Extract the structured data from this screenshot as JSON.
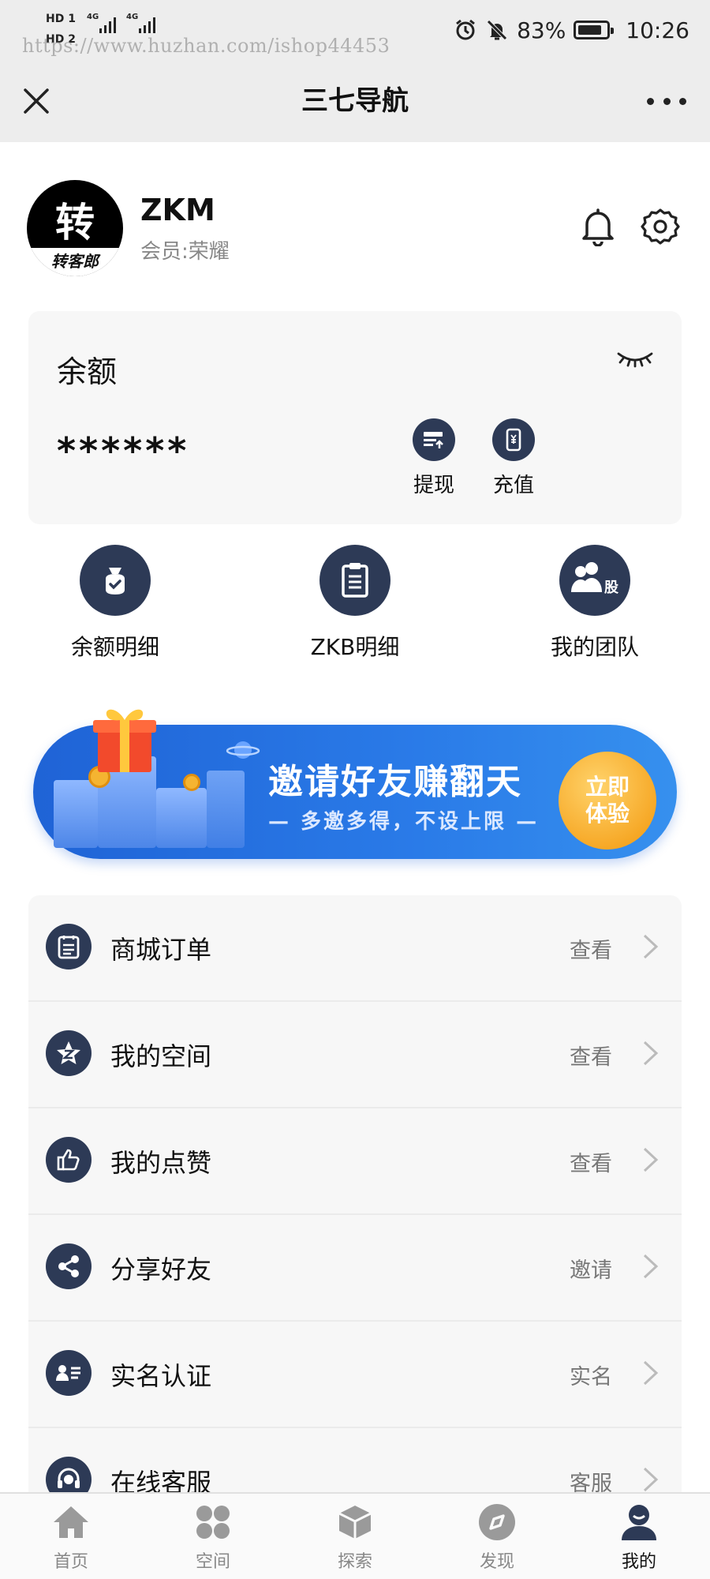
{
  "status_bar": {
    "net1": "HD 1",
    "net2": "HD 2",
    "signal1": "4G",
    "signal2": "4G",
    "watermark": "https://www.huzhan.com/ishop44453",
    "battery": "83%",
    "battery_level": 0.83,
    "time": "10:26",
    "icons": [
      "alarm-icon",
      "mute-icon",
      "battery-icon"
    ]
  },
  "title_bar": {
    "title": "三七导航",
    "close_icon": "close-icon",
    "more_icon": "more-icon"
  },
  "profile": {
    "avatar_main": "转",
    "avatar_band": "转客郎",
    "name": "ZKM",
    "member_level": "会员:荣耀",
    "icons": [
      "bell-icon",
      "gear-icon"
    ]
  },
  "balance": {
    "title": "余额",
    "value": "******",
    "hidden_icon": "eye-closed-icon",
    "actions": [
      {
        "label": "提现",
        "icon": "withdraw-icon"
      },
      {
        "label": "充值",
        "icon": "recharge-icon"
      }
    ]
  },
  "quick_links": [
    {
      "label": "余额明细",
      "icon": "money-bag-icon"
    },
    {
      "label": "ZKB明细",
      "icon": "clipboard-icon"
    },
    {
      "label": "我的团队",
      "icon": "team-icon",
      "badge": "股"
    }
  ],
  "banner": {
    "title": "邀请好友赚翻天",
    "subtitle": "— 多邀多得，不设上限 —",
    "button_line1": "立即",
    "button_line2": "体验"
  },
  "menu": [
    {
      "label": "商城订单",
      "action": "查看",
      "icon": "order-icon"
    },
    {
      "label": "我的空间",
      "action": "查看",
      "icon": "space-icon"
    },
    {
      "label": "我的点赞",
      "action": "查看",
      "icon": "thumbs-up-icon"
    },
    {
      "label": "分享好友",
      "action": "邀请",
      "icon": "share-icon"
    },
    {
      "label": "实名认证",
      "action": "实名",
      "icon": "id-card-icon"
    },
    {
      "label": "在线客服",
      "action": "客服",
      "icon": "headset-icon"
    }
  ],
  "bottom_nav": {
    "active": 4,
    "items": [
      {
        "label": "首页",
        "icon": "home-icon"
      },
      {
        "label": "空间",
        "icon": "grid-icon"
      },
      {
        "label": "探索",
        "icon": "cube-icon"
      },
      {
        "label": "发现",
        "icon": "compass-icon"
      },
      {
        "label": "我的",
        "icon": "user-icon"
      }
    ]
  },
  "colors": {
    "accent": "#2d3a56",
    "banner": "#2a7be8",
    "banner_button": "#f6a623",
    "bar": "#ededed"
  }
}
